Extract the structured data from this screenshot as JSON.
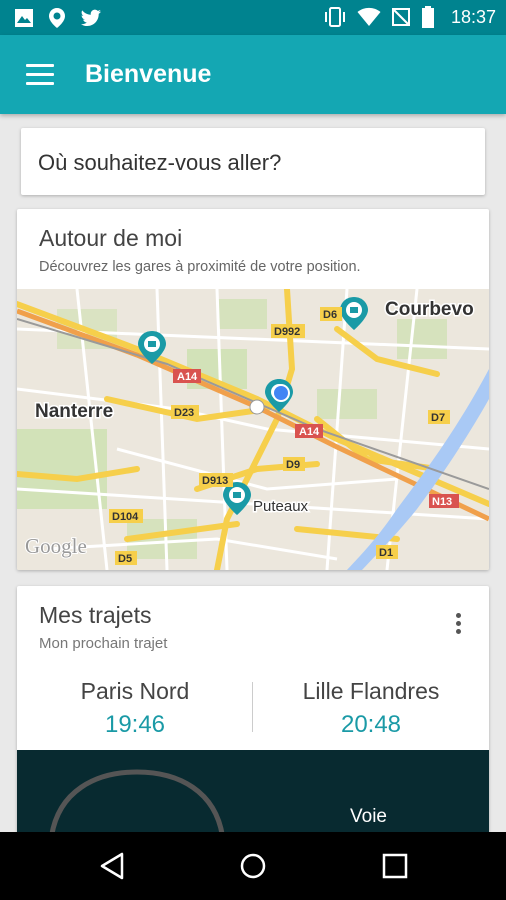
{
  "status_bar": {
    "time": "18:37",
    "icons": [
      "gallery-icon",
      "location-pin-icon",
      "twitter-icon",
      "vibrate-icon",
      "wifi-icon",
      "no-sim-icon",
      "battery-icon"
    ]
  },
  "app_bar": {
    "title": "Bienvenue",
    "menu_icon": "hamburger-menu-icon"
  },
  "search": {
    "placeholder": "Où souhaitez-vous aller?"
  },
  "nearby": {
    "title": "Autour de moi",
    "subtitle": "Découvrez les gares à proximité de votre position.",
    "map": {
      "labels": {
        "nanterre": "Nanterre",
        "courbevoie": "Courbevo",
        "puteaux": "Puteaux",
        "google": "Google"
      },
      "road_labels": [
        "A14",
        "A14",
        "D992",
        "D6",
        "D23",
        "D913",
        "D9",
        "D7",
        "N13",
        "D104",
        "D5",
        "D1"
      ]
    }
  },
  "trips": {
    "title": "Mes trajets",
    "subtitle": "Mon prochain trajet",
    "menu_icon": "more-vert-icon",
    "origin": {
      "station": "Paris Nord",
      "time": "19:46"
    },
    "destination": {
      "station": "Lille Flandres",
      "time": "20:48"
    },
    "platform_label": "Voie"
  },
  "nav_bar": {
    "back": "back-icon",
    "home": "home-icon",
    "recents": "recents-icon"
  },
  "colors": {
    "status_bar": "#00838f",
    "app_bar": "#14a7b3",
    "accent_time": "#1a9aa6",
    "dark_panel": "#082a30"
  }
}
